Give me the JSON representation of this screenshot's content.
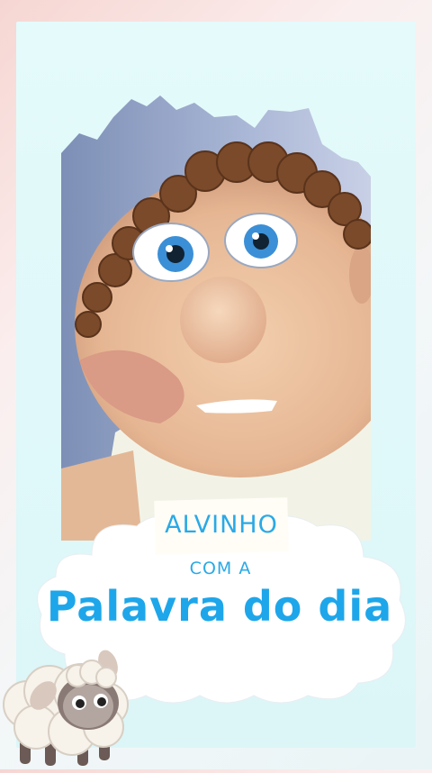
{
  "card": {
    "title_top": "ALVINHO",
    "title_sub": "COM A",
    "title_main": "Palavra do dia"
  },
  "colors": {
    "title": "#1ea6ea",
    "frame": "#e1f8fa",
    "cloud": "#ffffff"
  },
  "icons": [
    "sheep-icon",
    "cloud-shape"
  ]
}
